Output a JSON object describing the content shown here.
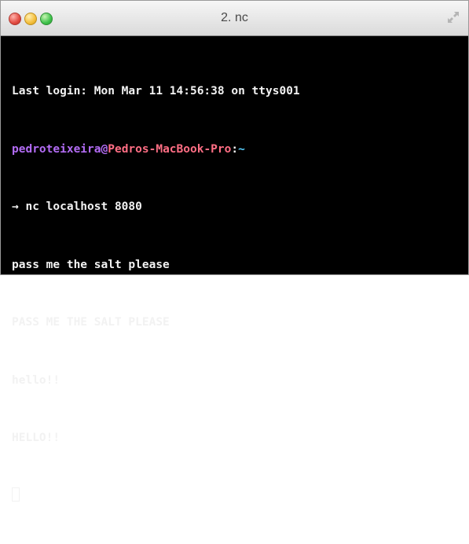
{
  "window": {
    "title": "2. nc",
    "controls": [
      "close",
      "minimize",
      "maximize"
    ],
    "fullscreen_icon": "fullscreen-arrows-icon"
  },
  "terminal": {
    "last_login": "Last login: Mon Mar 11 14:56:38 on ttys001",
    "prompt": {
      "user": "pedroteixeira",
      "at": "@",
      "host": "Pedros-MacBook-Pro",
      "colon": ":",
      "path": "~"
    },
    "command_line": "→ nc localhost 8080",
    "output": [
      "pass me the salt please",
      "PASS ME THE SALT PLEASE",
      "hello!!",
      "HELLO!!"
    ]
  },
  "colors": {
    "background": "#000000",
    "text": "#f2f2f2",
    "user": "#b36cf5",
    "host": "#ff6e84",
    "path": "#57d0ff"
  }
}
